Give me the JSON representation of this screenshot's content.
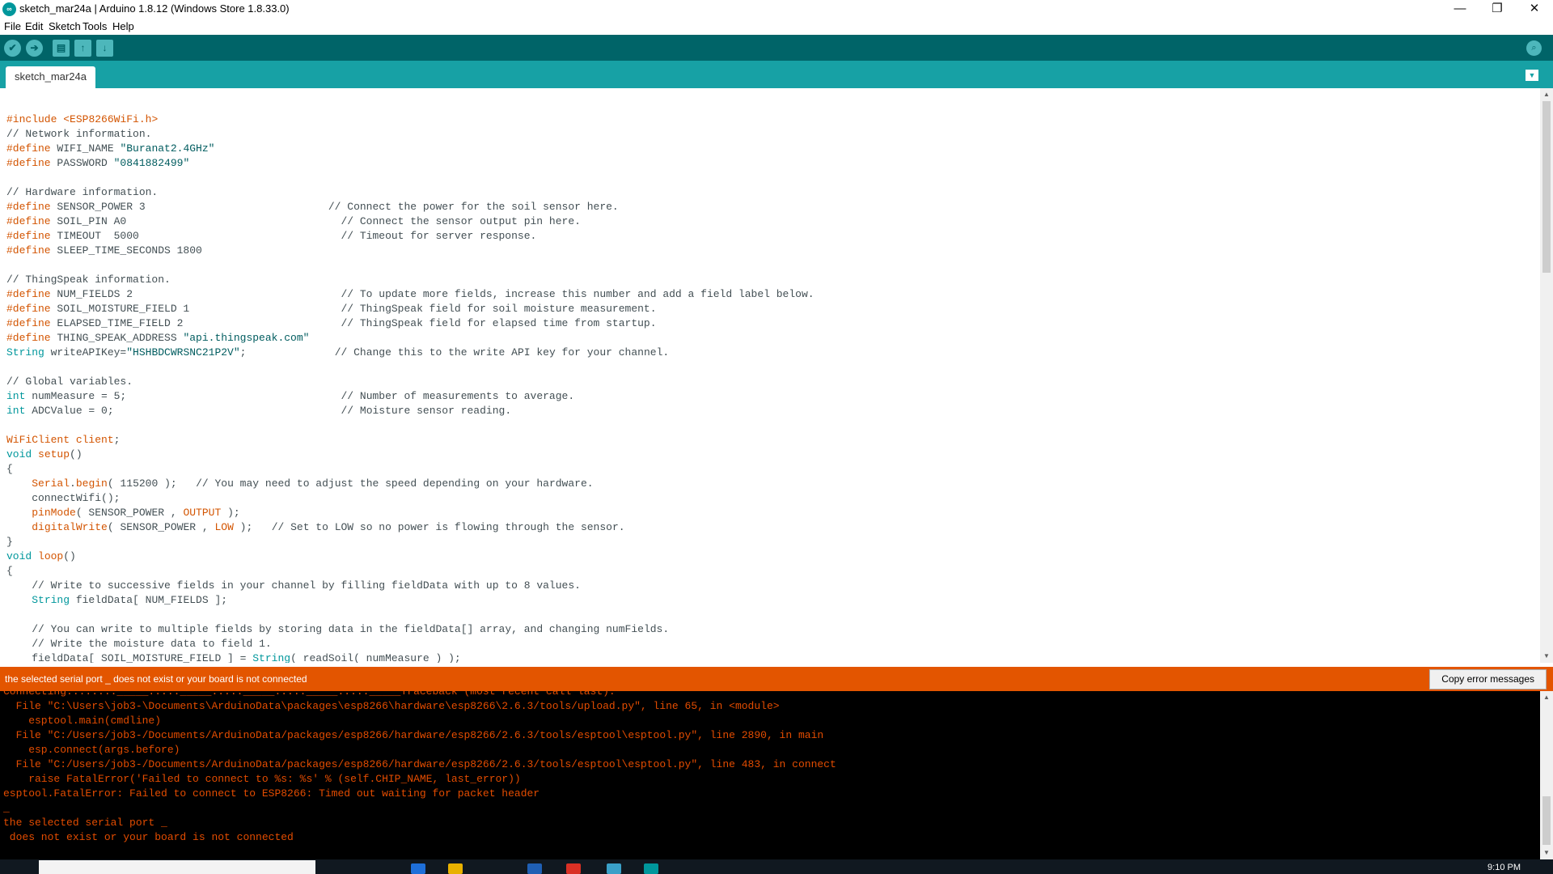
{
  "window": {
    "title": "sketch_mar24a | Arduino 1.8.12 (Windows Store 1.8.33.0)",
    "app_icon": "arduino-logo",
    "controls": {
      "minimize": "—",
      "maximize": "❐",
      "close": "✕"
    }
  },
  "menu": [
    "File",
    "Edit",
    "Sketch",
    "Tools",
    "Help"
  ],
  "toolbar": {
    "verify_icon": "✔",
    "upload_icon": "➔",
    "new_icon": "▤",
    "open_icon": "↑",
    "save_icon": "↓",
    "serial_icon": "⌕"
  },
  "tabs": [
    {
      "label": "sketch_mar24a",
      "active": true
    }
  ],
  "tab_menu_icon": "▼",
  "code": [
    "",
    "#include <ESP8266WiFi.h>",
    "// Network information.",
    "#define WIFI_NAME \"Buranat2.4GHz\"",
    "#define PASSWORD \"0841882499\"",
    "",
    "// Hardware information.",
    "#define SENSOR_POWER 3                             // Connect the power for the soil sensor here.",
    "#define SOIL_PIN A0                                  // Connect the sensor output pin here.",
    "#define TIMEOUT  5000                                // Timeout for server response.",
    "#define SLEEP_TIME_SECONDS 1800",
    "",
    "// ThingSpeak information.",
    "#define NUM_FIELDS 2                                 // To update more fields, increase this number and add a field label below.",
    "#define SOIL_MOISTURE_FIELD 1                        // ThingSpeak field for soil moisture measurement.",
    "#define ELAPSED_TIME_FIELD 2                         // ThingSpeak field for elapsed time from startup.",
    "#define THING_SPEAK_ADDRESS \"api.thingspeak.com\"",
    "String writeAPIKey=\"HSHBDCWRSNC21P2V\";              // Change this to the write API key for your channel.",
    "",
    "// Global variables.",
    "int numMeasure = 5;                                  // Number of measurements to average.",
    "int ADCValue = 0;                                    // Moisture sensor reading.",
    "",
    "WiFiClient client;",
    "void setup()",
    "{",
    "    Serial.begin( 115200 );   // You may need to adjust the speed depending on your hardware.",
    "    connectWifi();",
    "    pinMode( SENSOR_POWER , OUTPUT );",
    "    digitalWrite( SENSOR_POWER , LOW );   // Set to LOW so no power is flowing through the sensor.",
    "}",
    "void loop()",
    "{",
    "    // Write to successive fields in your channel by filling fieldData with up to 8 values.",
    "    String fieldData[ NUM_FIELDS ];",
    "",
    "    // You can write to multiple fields by storing data in the fieldData[] array, and changing numFields.",
    "    // Write the moisture data to field 1.",
    "    fieldData[ SOIL_MOISTURE_FIELD ] = String( readSoil( numMeasure ) );"
  ],
  "status": {
    "message": "the selected serial port _ does not exist or your board is not connected",
    "copy_button": "Copy error messages"
  },
  "console": [
    "Connecting........_____....._____....._____....._____....._____Traceback (most recent call last):",
    "  File \"C:\\Users\\job3-\\Documents\\ArduinoData\\packages\\esp8266\\hardware\\esp8266\\2.6.3/tools/upload.py\", line 65, in <module>",
    "    esptool.main(cmdline)",
    "  File \"C:/Users/job3-/Documents/ArduinoData/packages/esp8266/hardware/esp8266/2.6.3/tools/esptool\\esptool.py\", line 2890, in main",
    "    esp.connect(args.before)",
    "  File \"C:/Users/job3-/Documents/ArduinoData/packages/esp8266/hardware/esp8266/2.6.3/tools/esptool\\esptool.py\", line 483, in connect",
    "    raise FatalError('Failed to connect to %s: %s' % (self.CHIP_NAME, last_error))",
    "esptool.FatalError: Failed to connect to ESP8266: Timed out waiting for packet header",
    "_",
    "the selected serial port _",
    " does not exist or your board is not connected"
  ],
  "taskbar": {
    "clock": "9:10 PM"
  },
  "colors": {
    "toolbar": "#006468",
    "tabbar": "#17a1a5",
    "status": "#e35500",
    "console_text": "#e34c00"
  }
}
